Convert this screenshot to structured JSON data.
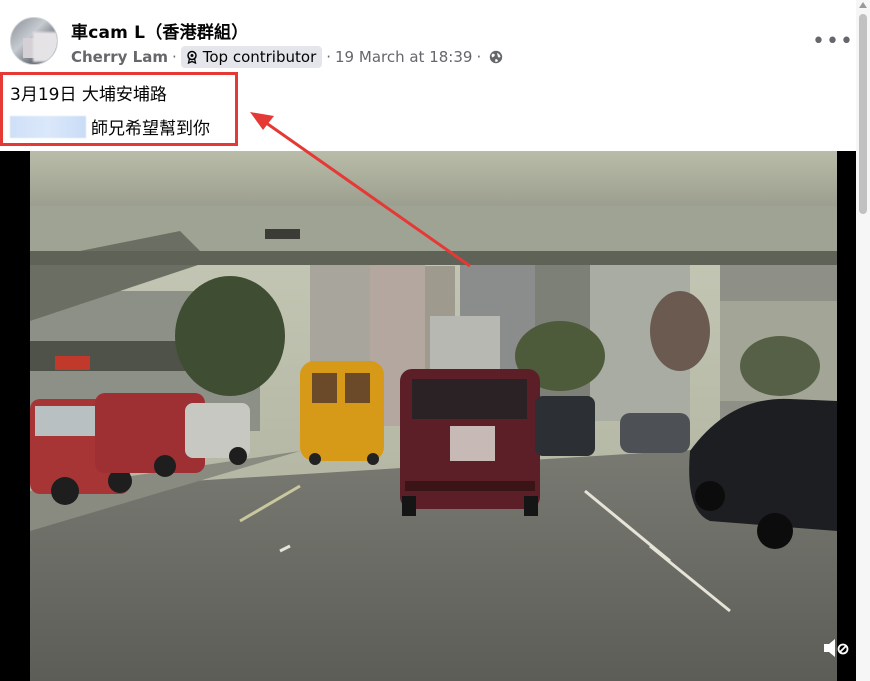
{
  "post": {
    "group_name": "車cam L（香港群組）",
    "author": "Cherry Lam",
    "badge_label": "Top contributor",
    "timestamp": "19 March at 18:39",
    "separator": "·",
    "more_label": "•••",
    "text_line1": "3月19日 大埔安埔路",
    "text_line2": "師兄希望幫到你"
  },
  "icons": {
    "badge": "top-contributor-badge-icon",
    "privacy": "globe-icon",
    "more": "more-options-icon",
    "mute": "speaker-muted-icon"
  },
  "colors": {
    "annotation_red": "#e53935",
    "meta_gray": "#65676b",
    "badge_bg": "#e4e6eb"
  }
}
